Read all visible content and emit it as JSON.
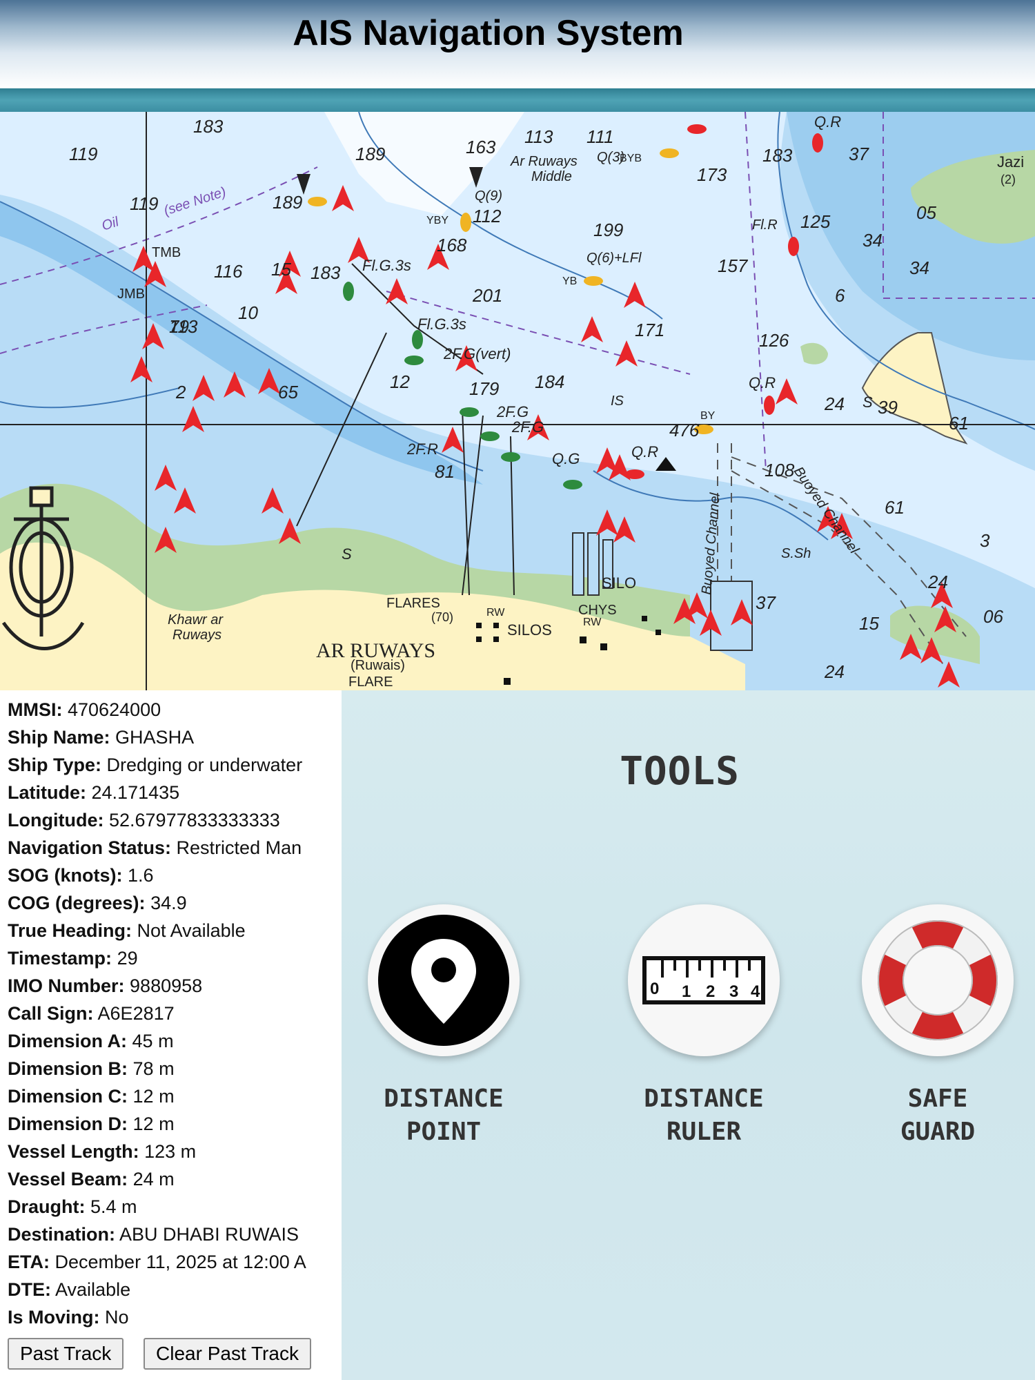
{
  "header": {
    "title": "AIS Navigation System"
  },
  "map": {
    "labels": {
      "place_main": "AR RUWAYS",
      "place_sub": "(Ruwais)",
      "flare": "FLARE",
      "flares": "FLARES",
      "flares_height": "(70)",
      "silos": "SILOS",
      "silo": "SILO",
      "chys": "CHYS",
      "rw1": "RW",
      "rw2": "RW",
      "khawr": "Khawr ar",
      "khawr2": "Ruways",
      "ar_ruways_middle1": "Ar Ruways",
      "ar_ruways_middle2": "Middle",
      "jazira": "Jazi",
      "jazira_num": "(2)",
      "buoyed_channel_1": "Buoyed Channel",
      "buoyed_channel_2": "Buoyed Channel",
      "oil": "Oil",
      "see_note": "(see Note)",
      "tmb": "TMB",
      "jmb": "JMB",
      "s_sh": "S.Sh",
      "is": "IS",
      "s1": "S",
      "s2": "S",
      "light_flg3s_1": "Fl.G.3s",
      "light_flg3s_2": "Fl.G.3s",
      "light_2fg_vert": "2F.G(vert)",
      "light_2fg_1": "2F.G",
      "light_2fg_2": "2F.G",
      "light_2fr": "2F.R",
      "light_qg": "Q.G",
      "light_qr_1": "Q.R",
      "light_qr_2": "Q.R",
      "light_qr_3": "Q.R",
      "light_q9": "Q(9)",
      "light_q3": "Q(3)",
      "light_q6": "Q(6)+LFl",
      "light_flr": "Fl.R",
      "bys_ybb": "BYB",
      "bys_yby": "YBY",
      "bys_yb": "YB",
      "bys_by": "BY",
      "depths": [
        "183",
        "119",
        "163",
        "113",
        "111",
        "189",
        "189",
        "173",
        "183",
        "125",
        "37",
        "34",
        "34",
        "112",
        "199",
        "168",
        "157",
        "6",
        "119",
        "116",
        "183",
        "201",
        "171",
        "113",
        "79",
        "184",
        "126",
        "179",
        "12",
        "24",
        "39",
        "61",
        "65",
        "108",
        "61",
        "3",
        "24",
        "06",
        "15",
        "81",
        "476",
        "37",
        "24",
        "2",
        "10",
        "15",
        "05"
      ]
    }
  },
  "vessel": [
    {
      "label": "MMSI:",
      "value": "470624000"
    },
    {
      "label": "Ship Name:",
      "value": "GHASHA"
    },
    {
      "label": "Ship Type:",
      "value": "Dredging or underwater"
    },
    {
      "label": "Latitude:",
      "value": "24.171435"
    },
    {
      "label": "Longitude:",
      "value": "52.67977833333333"
    },
    {
      "label": "Navigation Status:",
      "value": "Restricted Man"
    },
    {
      "label": "SOG (knots):",
      "value": "1.6"
    },
    {
      "label": "COG (degrees):",
      "value": "34.9"
    },
    {
      "label": "True Heading:",
      "value": "Not Available"
    },
    {
      "label": "Timestamp:",
      "value": "29"
    },
    {
      "label": "IMO Number:",
      "value": "9880958"
    },
    {
      "label": "Call Sign:",
      "value": "A6E2817"
    },
    {
      "label": "Dimension A:",
      "value": "45 m"
    },
    {
      "label": "Dimension B:",
      "value": "78 m"
    },
    {
      "label": "Dimension C:",
      "value": "12 m"
    },
    {
      "label": "Dimension D:",
      "value": "12 m"
    },
    {
      "label": "Vessel Length:",
      "value": "123 m"
    },
    {
      "label": "Vessel Beam:",
      "value": "24 m"
    },
    {
      "label": "Draught:",
      "value": "5.4 m"
    },
    {
      "label": "Destination:",
      "value": "ABU DHABI RUWAIS"
    },
    {
      "label": "ETA:",
      "value": "December 11, 2025 at 12:00 A"
    },
    {
      "label": "DTE:",
      "value": "Available"
    },
    {
      "label": "Is Moving:",
      "value": "No"
    }
  ],
  "buttons": {
    "past_track": "Past Track",
    "clear_past_track": "Clear Past Track"
  },
  "tools": {
    "title": "TOOLS",
    "items": [
      {
        "label": "DISTANCE\nPOINT",
        "icon": "map-pin-icon"
      },
      {
        "label": "DISTANCE\nRULER",
        "icon": "ruler-icon"
      },
      {
        "label": "SAFE\nGUARD",
        "icon": "lifebuoy-icon"
      }
    ],
    "ruler_digits": [
      "0",
      "1",
      "2",
      "3",
      "4"
    ]
  },
  "colors": {
    "vessel_marker": "#e8262a",
    "sea_light": "#dcefff",
    "sea_mid": "#b8dcf6",
    "sea_deep": "#8fc6ee",
    "land": "#fdf3c4",
    "land_green": "#b7d7a5"
  }
}
